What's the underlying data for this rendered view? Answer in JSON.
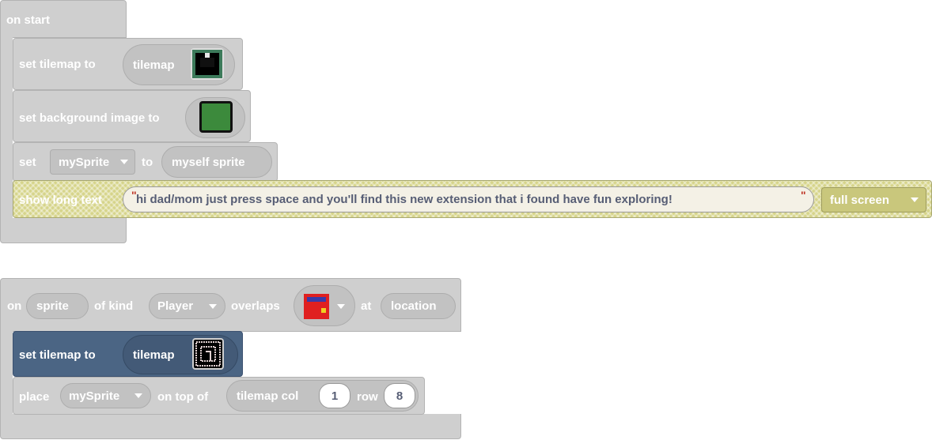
{
  "on_start": {
    "hat_label": "on start",
    "set_tilemap": {
      "label": "set tilemap to",
      "value": "tilemap"
    },
    "set_background": {
      "label": "set background image to"
    },
    "set_variable": {
      "label_set": "set",
      "variable": "mySprite",
      "label_to": "to",
      "value": "myself sprite"
    },
    "show_long_text": {
      "label": "show long text",
      "text": "hi dad/mom just press space and you'll find this new extension that i found have fun exploring!",
      "mode": "full screen"
    }
  },
  "overlap_event": {
    "label_on": "on",
    "sprite_param": "sprite",
    "label_of_kind": "of kind",
    "kind": "Player",
    "label_overlaps": "overlaps",
    "label_at": "at",
    "location_param": "location",
    "set_tilemap": {
      "label": "set tilemap to",
      "value": "tilemap"
    },
    "place": {
      "label": "place",
      "variable": "mySprite",
      "label_on_top_of": "on top of",
      "tilemap_label": "tilemap col",
      "col": "1",
      "label_row": "row",
      "row": "8"
    }
  },
  "colors": {
    "block_gray": "#cfcfcf",
    "block_blue": "#4b6584",
    "tilemap_green": "#3c8a3c",
    "sprite_red": "#e02020",
    "sprite_blue": "#3a3aa8",
    "sprite_yellow": "#f0d020"
  }
}
